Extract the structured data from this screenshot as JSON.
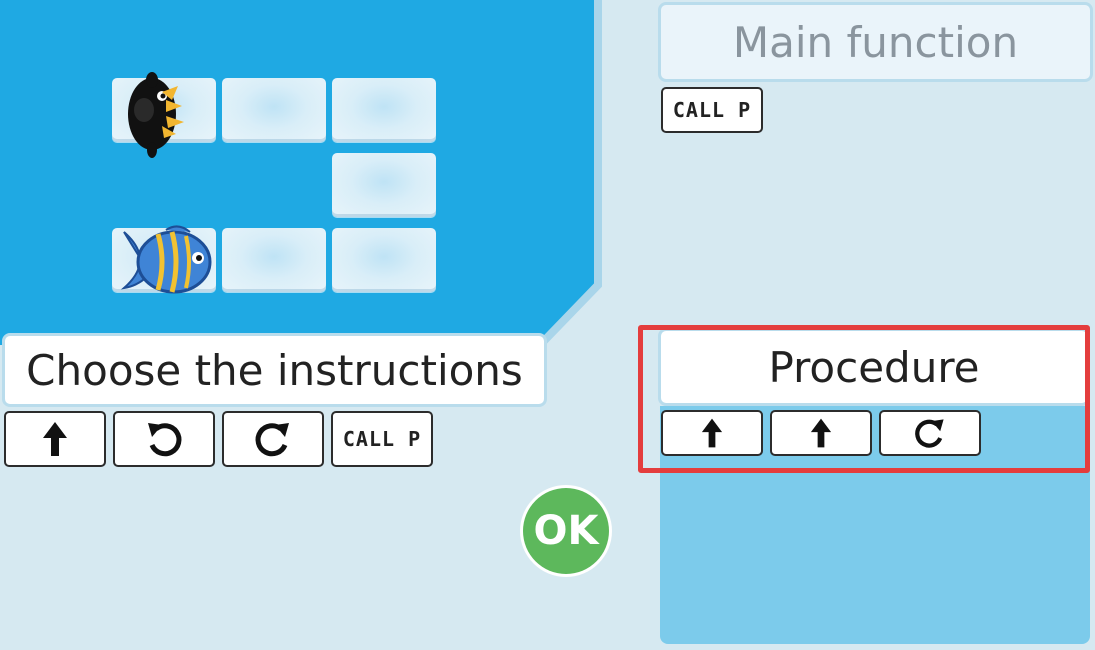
{
  "instructions_panel": {
    "title": "Choose the instructions",
    "blocks": [
      {
        "icon": "forward-arrow-icon"
      },
      {
        "icon": "turn-left-icon"
      },
      {
        "icon": "turn-right-icon"
      },
      {
        "label": "CALL P"
      }
    ]
  },
  "main_function": {
    "title": "Main function",
    "blocks": [
      {
        "label": "CALL P"
      }
    ]
  },
  "procedure": {
    "title": "Procedure",
    "blocks": [
      {
        "icon": "forward-arrow-icon"
      },
      {
        "icon": "forward-arrow-icon"
      },
      {
        "icon": "turn-right-icon"
      }
    ]
  },
  "ok_button": {
    "label": "OK"
  },
  "board": {
    "characters": [
      "penguin-icon",
      "fish-icon"
    ]
  },
  "colors": {
    "water": "#1fa9e3",
    "background": "#d6e9f1",
    "procedure_area": "#7ccbeb",
    "highlight": "#e43d3d",
    "ok_green": "#5db85c"
  }
}
